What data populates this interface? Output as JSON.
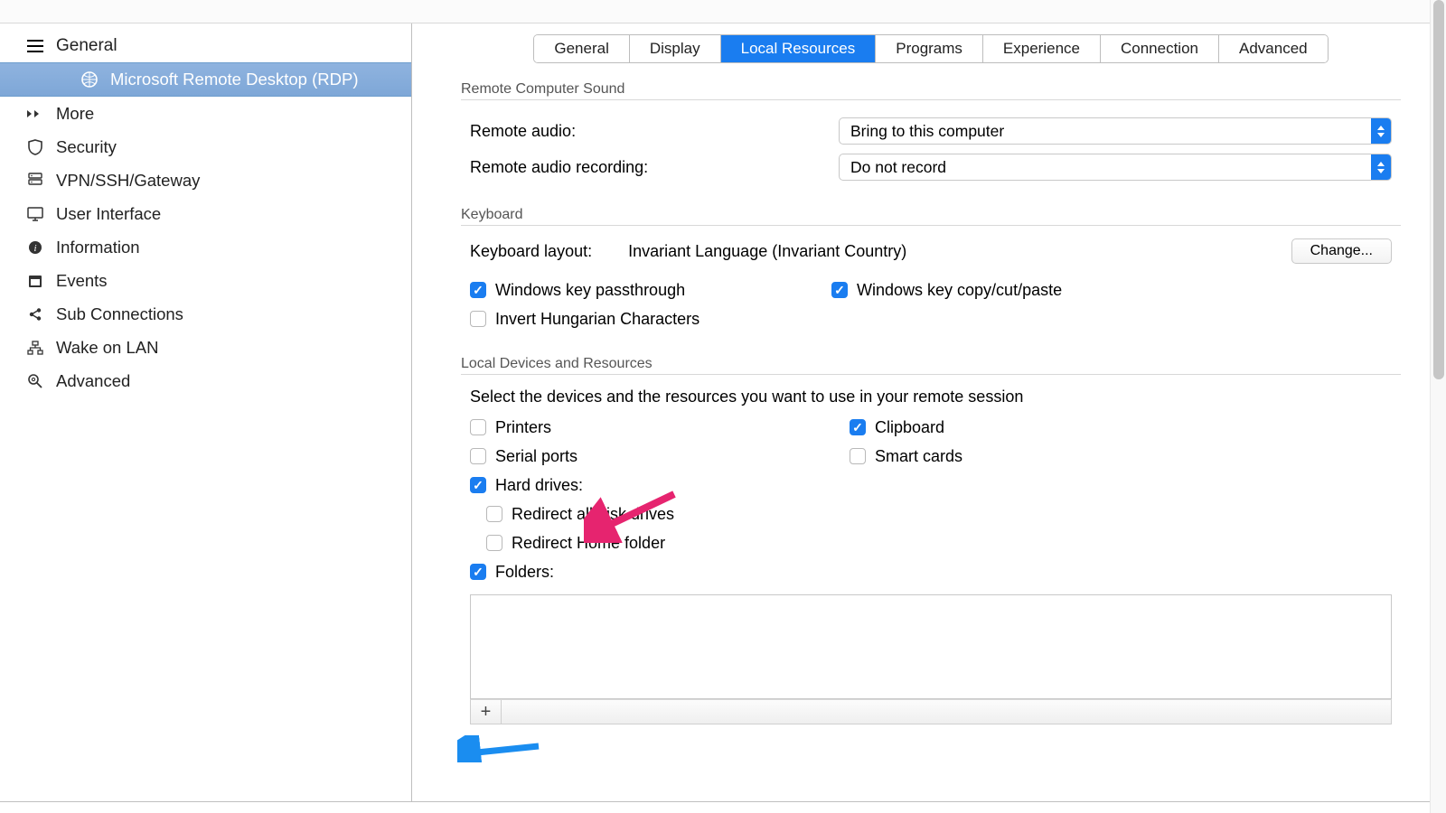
{
  "sidebar": {
    "header": "General",
    "selected_child": "Microsoft Remote Desktop (RDP)",
    "items": [
      {
        "icon": "more",
        "label": "More"
      },
      {
        "icon": "shield",
        "label": "Security"
      },
      {
        "icon": "server",
        "label": "VPN/SSH/Gateway"
      },
      {
        "icon": "monitor",
        "label": "User Interface"
      },
      {
        "icon": "info",
        "label": "Information"
      },
      {
        "icon": "calendar",
        "label": "Events"
      },
      {
        "icon": "share",
        "label": "Sub Connections"
      },
      {
        "icon": "network",
        "label": "Wake on LAN"
      },
      {
        "icon": "search-gear",
        "label": "Advanced"
      }
    ]
  },
  "tabs": [
    "General",
    "Display",
    "Local Resources",
    "Programs",
    "Experience",
    "Connection",
    "Advanced"
  ],
  "tabs_active": "Local Resources",
  "sound": {
    "group_title": "Remote Computer Sound",
    "remote_audio_label": "Remote audio:",
    "remote_audio_value": "Bring to this computer",
    "remote_recording_label": "Remote audio recording:",
    "remote_recording_value": "Do not record"
  },
  "keyboard": {
    "group_title": "Keyboard",
    "layout_label": "Keyboard layout:",
    "layout_value": "Invariant Language (Invariant Country)",
    "change_label": "Change...",
    "passthrough_label": "Windows key passthrough",
    "copypaste_label": "Windows key copy/cut/paste",
    "invert_hu_label": "Invert Hungarian Characters"
  },
  "local": {
    "group_title": "Local Devices and Resources",
    "hint": "Select the devices and the resources you want to use in your remote session",
    "printers": "Printers",
    "serial": "Serial ports",
    "hard_drives": "Hard drives:",
    "redir_all": "Redirect all disk drives",
    "redir_home": "Redirect Home folder",
    "folders": "Folders:",
    "clipboard": "Clipboard",
    "smartcards": "Smart cards"
  },
  "buttons": {
    "plus": "+"
  }
}
